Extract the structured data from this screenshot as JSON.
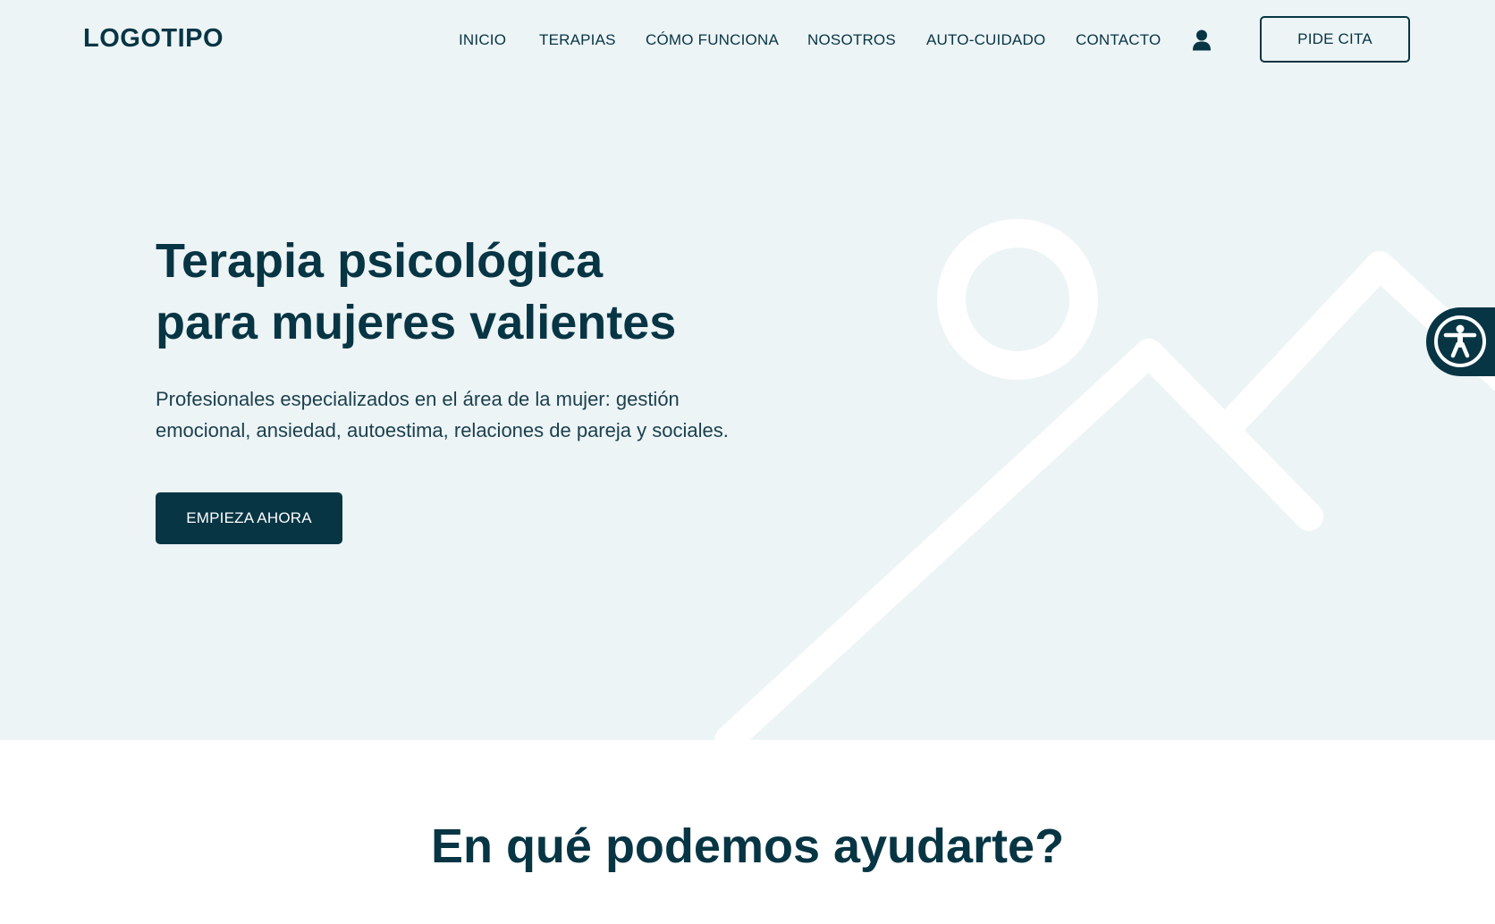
{
  "brand": {
    "logo_text": "LOGOTIPO"
  },
  "nav": {
    "items": [
      {
        "label": "INICIO"
      },
      {
        "label": "TERAPIAS"
      },
      {
        "label": "CÓMO FUNCIONA"
      },
      {
        "label": "NOSOTROS"
      },
      {
        "label": "AUTO-CUIDADO"
      },
      {
        "label": "CONTACTO"
      }
    ],
    "user_icon": "user-icon",
    "cta_label": "PIDE CITA"
  },
  "hero": {
    "title_lines": [
      "Terapia psicológica",
      "para mujeres valientes"
    ],
    "description_lines": [
      "Profesionales especializados en el área de la mujer: gestión",
      "emocional, ansiedad, autoestima, relaciones de pareja y sociales."
    ],
    "cta_label": "EMPIEZA AHORA",
    "decor_icon": "mountain-sun-illustration"
  },
  "accessibility": {
    "icon": "accessibility-icon"
  },
  "services": {
    "title": "En qué podemos ayudarte?"
  },
  "colors": {
    "primary": "#073544",
    "hero_background": "#edf4f6",
    "page_background": "#ffffff",
    "decor": "#ffffff"
  }
}
